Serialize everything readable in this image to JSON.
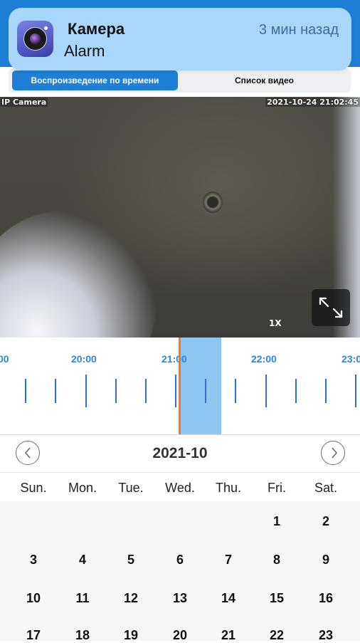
{
  "notification": {
    "app_name": "Камера",
    "message": "Alarm",
    "time": "3 мин назад",
    "icon": "camera-app-icon"
  },
  "tabs": {
    "active": "Воспроизведение по времени",
    "inactive": "Список видео"
  },
  "video": {
    "camera_label": "IP Camera",
    "timestamp": "2021-10-24 21:02:45",
    "zoom": "1X",
    "fullscreen_icon": "expand-icon"
  },
  "timeline": {
    "labels": [
      "00",
      "20:00",
      "21:00",
      "22:00",
      "23:0"
    ]
  },
  "calendar": {
    "month": "2021-10",
    "prev_icon": "chevron-left-icon",
    "next_icon": "chevron-right-icon",
    "weekdays": [
      "Sun.",
      "Mon.",
      "Tue.",
      "Wed.",
      "Thu.",
      "Fri.",
      "Sat."
    ],
    "weeks": [
      [
        "",
        "",
        "",
        "",
        "",
        "1",
        "2"
      ],
      [
        "3",
        "4",
        "5",
        "6",
        "7",
        "8",
        "9"
      ],
      [
        "10",
        "11",
        "12",
        "13",
        "14",
        "15",
        "16"
      ],
      [
        "17",
        "18",
        "19",
        "20",
        "21",
        "22",
        "23"
      ]
    ]
  },
  "colors": {
    "accent": "#1e7fd6",
    "timeline_highlight": "#8ec5f1",
    "playhead": "#f07a2a"
  }
}
